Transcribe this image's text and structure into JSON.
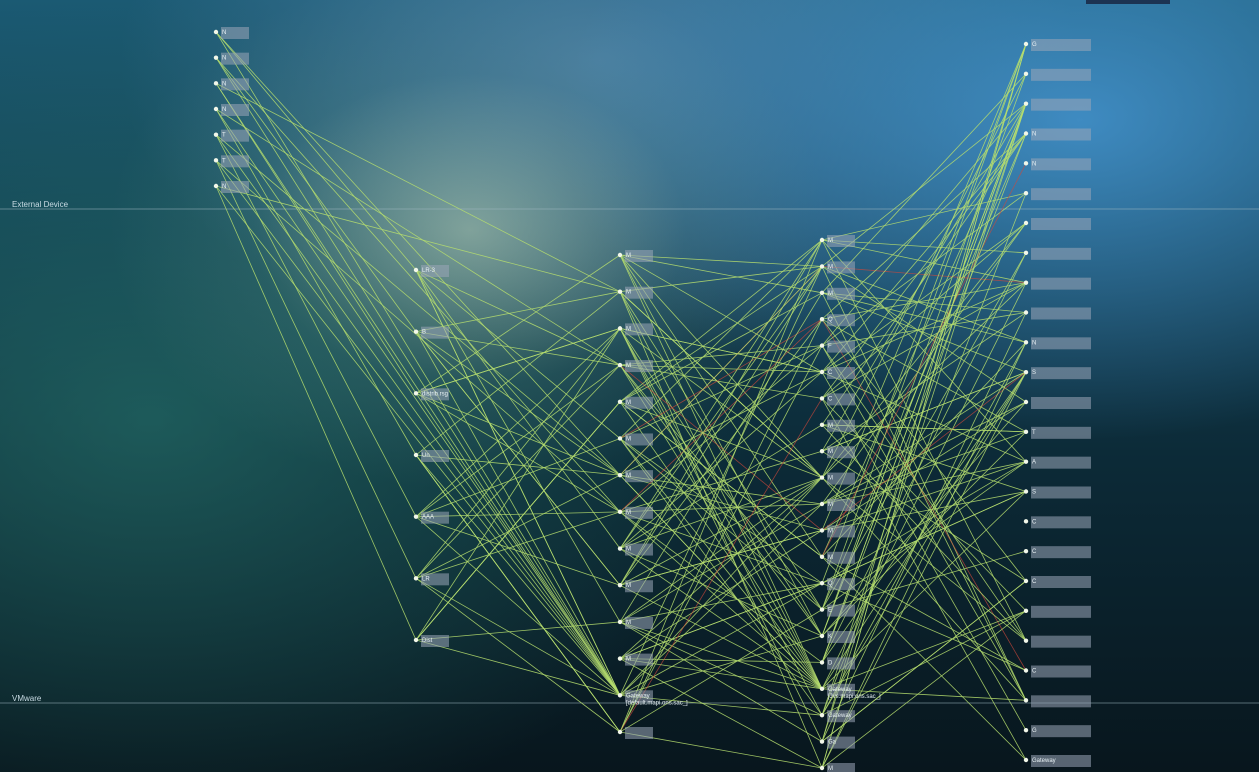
{
  "lanes": [
    {
      "label": "External Device"
    },
    {
      "label": "VMware"
    }
  ],
  "colors": {
    "edge": "#b6de6e",
    "edge_alert": "#d0483a",
    "node": "#f2f7e9"
  },
  "columns": [
    {
      "id": "c0",
      "nodes": [
        {
          "id": "a0",
          "label": "N"
        },
        {
          "id": "a1",
          "label": "N"
        },
        {
          "id": "a2",
          "label": "N"
        },
        {
          "id": "a3",
          "label": "N"
        },
        {
          "id": "a4",
          "label": "T"
        },
        {
          "id": "a5",
          "label": "T"
        },
        {
          "id": "a6",
          "label": "N"
        }
      ]
    },
    {
      "id": "c1",
      "nodes": [
        {
          "id": "b0",
          "label": "LR-3",
          "sub": ""
        },
        {
          "id": "b1",
          "label": "B"
        },
        {
          "id": "b2",
          "label": "distrib.rsg"
        },
        {
          "id": "b3",
          "label": "Un"
        },
        {
          "id": "b4",
          "label": "AAA"
        },
        {
          "id": "b5",
          "label": "LR"
        },
        {
          "id": "b6",
          "label": "Dist"
        }
      ]
    },
    {
      "id": "c2",
      "nodes": [
        {
          "id": "c0n",
          "label": "M"
        },
        {
          "id": "c1n",
          "label": "M"
        },
        {
          "id": "c2n",
          "label": "M"
        },
        {
          "id": "c3n",
          "label": "M"
        },
        {
          "id": "c4n",
          "label": "M"
        },
        {
          "id": "c5n",
          "label": "M"
        },
        {
          "id": "c6n",
          "label": "M"
        },
        {
          "id": "c7n",
          "label": "M"
        },
        {
          "id": "c8n",
          "label": "M"
        },
        {
          "id": "c9n",
          "label": "M"
        },
        {
          "id": "c10n",
          "label": "M"
        },
        {
          "id": "c11n",
          "label": "M"
        },
        {
          "id": "c12n",
          "label": "Gateway",
          "sub": "[default.mapi.ons.sac_]"
        },
        {
          "id": "c13n",
          "label": ""
        }
      ]
    },
    {
      "id": "c3",
      "nodes": [
        {
          "id": "d0",
          "label": "M"
        },
        {
          "id": "d1",
          "label": "M"
        },
        {
          "id": "d2",
          "label": "M"
        },
        {
          "id": "d3",
          "label": "Q"
        },
        {
          "id": "d4",
          "label": "F"
        },
        {
          "id": "d5",
          "label": "C"
        },
        {
          "id": "d6",
          "label": "C"
        },
        {
          "id": "d7",
          "label": "M"
        },
        {
          "id": "d8",
          "label": "M"
        },
        {
          "id": "d9",
          "label": "M"
        },
        {
          "id": "d10",
          "label": "M"
        },
        {
          "id": "d11",
          "label": "M"
        },
        {
          "id": "d12",
          "label": "M"
        },
        {
          "id": "d13",
          "label": "Q"
        },
        {
          "id": "d14",
          "label": "E"
        },
        {
          "id": "d15",
          "label": "K"
        },
        {
          "id": "d16",
          "label": "D"
        },
        {
          "id": "d17",
          "label": "Gateway",
          "sub": "[Jvs.mapi.ons.sac_]"
        },
        {
          "id": "d18",
          "label": "Gateway",
          "sub": ""
        },
        {
          "id": "d19",
          "label": "Ga"
        },
        {
          "id": "d20",
          "label": "M"
        }
      ]
    },
    {
      "id": "c4",
      "nodes": [
        {
          "id": "e0",
          "label": "G"
        },
        {
          "id": "e1",
          "label": ""
        },
        {
          "id": "e2",
          "label": ""
        },
        {
          "id": "e3",
          "label": "N"
        },
        {
          "id": "e4",
          "label": "N"
        },
        {
          "id": "e5",
          "label": ""
        },
        {
          "id": "e6",
          "label": ""
        },
        {
          "id": "e7",
          "label": ""
        },
        {
          "id": "e8",
          "label": ""
        },
        {
          "id": "e9",
          "label": ""
        },
        {
          "id": "e10",
          "label": "N"
        },
        {
          "id": "e11",
          "label": "S"
        },
        {
          "id": "e12",
          "label": ""
        },
        {
          "id": "e13",
          "label": "T"
        },
        {
          "id": "e14",
          "label": "A"
        },
        {
          "id": "e15",
          "label": "S"
        },
        {
          "id": "e16",
          "label": "C"
        },
        {
          "id": "e17",
          "label": "C"
        },
        {
          "id": "e18",
          "label": "C"
        },
        {
          "id": "e19",
          "label": ""
        },
        {
          "id": "e20",
          "label": ""
        },
        {
          "id": "e21",
          "label": "C"
        },
        {
          "id": "e22",
          "label": ""
        },
        {
          "id": "e23",
          "label": "G"
        },
        {
          "id": "e24",
          "label": "Gateway"
        }
      ]
    }
  ]
}
